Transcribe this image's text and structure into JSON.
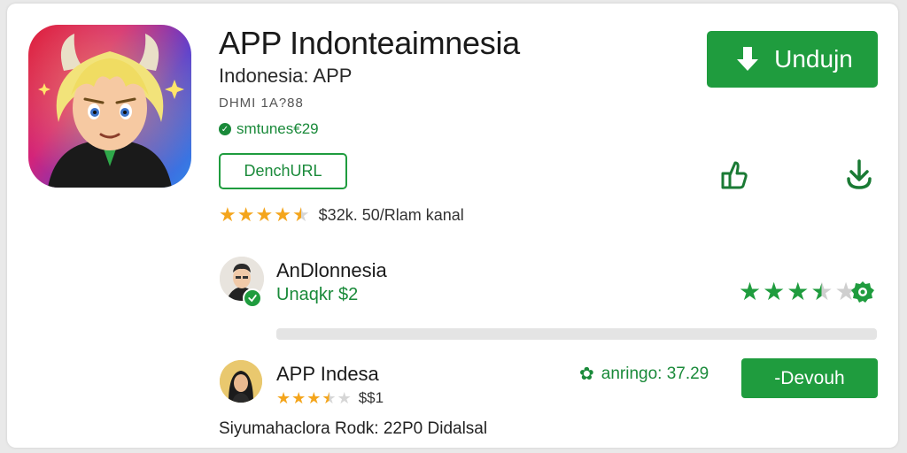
{
  "app": {
    "title": "APP Indonteaimnesia",
    "subtitle": "Indonesia: APP",
    "meta": "DHMI 1A?88",
    "verified_text": "smtunes€29",
    "outline_button_label": "DenchURL",
    "rating_stars": 4.5,
    "rating_text": "$32k. 50/Rlam kanal",
    "primary_button_label": "Undujn"
  },
  "colors": {
    "accent_green": "#1f9c3e",
    "star_gold": "#f4a51c",
    "star_green": "#1f9c3e"
  },
  "icons": {
    "primary_button_icon": "download-arrow-icon",
    "share": "share-icon",
    "download": "download-icon",
    "verified": "check-circle-icon",
    "item_badge": "gear-badge-icon"
  },
  "list": {
    "item1": {
      "name": "AnDlonnesia",
      "subtitle": "Unaqkr $2",
      "rating_stars": 3.5,
      "progress_fraction": 0.0
    },
    "item2": {
      "name": "APP Indesa",
      "rating_stars": 3.5,
      "price": "$$1",
      "meta_text": "anringo: 37.29",
      "button_label": "-Devouh"
    }
  },
  "footer_text": "Siyumahaclora Rodk: 22P0 Didalsal"
}
